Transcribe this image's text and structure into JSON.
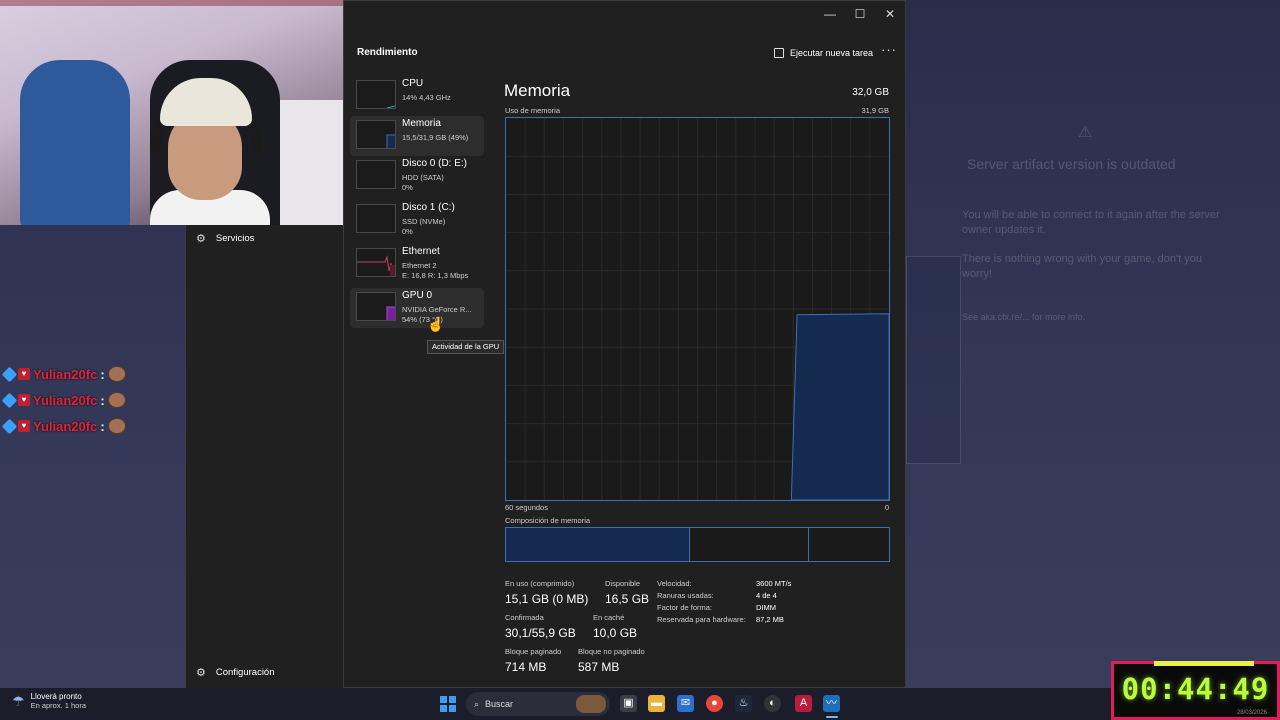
{
  "background_dialog": {
    "title": "Server artifact version is outdated",
    "p1": "You will be able to connect to it again after the server owner updates it.",
    "p2": "There is nothing wrong with your game, don't you worry!",
    "p3": "See aka.cfx.re/... for more info."
  },
  "nav": {
    "services_label": "Servicios",
    "settings_label": "Configuración"
  },
  "chat": {
    "messages": [
      {
        "user": "Yulian20fc",
        "sep": ":"
      },
      {
        "user": "Yulian20fc",
        "sep": ":"
      },
      {
        "user": "Yulian20fc",
        "sep": ":"
      }
    ]
  },
  "task_manager": {
    "section_title": "Rendimiento",
    "run_task_label": "Ejecutar nueva tarea",
    "more_label": "···",
    "window_buttons": {
      "minimize": "—",
      "maximize": "☐",
      "close": "✕"
    },
    "perf_items": [
      {
        "name": "CPU",
        "line1": "14% 4,43 GHz",
        "line2": ""
      },
      {
        "name": "Memoria",
        "line1": "15,5/31,9 GB (49%)",
        "line2": ""
      },
      {
        "name": "Disco 0 (D: E:)",
        "line1": "HDD (SATA)",
        "line2": "0%"
      },
      {
        "name": "Disco 1 (C:)",
        "line1": "SSD (NVMe)",
        "line2": "0%"
      },
      {
        "name": "Ethernet",
        "line1": "Ethernet 2",
        "line2": "E: 16,8 R: 1,3 Mbps"
      },
      {
        "name": "GPU 0",
        "line1": "NVIDIA GeForce R...",
        "line2": "54% (73 °C)"
      }
    ],
    "tooltip": "Actividad de la GPU",
    "memory": {
      "title": "Memoria",
      "total": "32,0 GB",
      "usage_label": "Uso de memoria",
      "usage_max": "31,9 GB",
      "axis_left": "60 segundos",
      "axis_right": "0",
      "composition_label": "Composición de memoria",
      "stats": [
        {
          "label": "En uso (comprimido)",
          "value": "15,1 GB (0 MB)"
        },
        {
          "label": "Disponible",
          "value": "16,5 GB"
        },
        {
          "label": "Confirmada",
          "value": "30,1/55,9 GB"
        },
        {
          "label": "En caché",
          "value": "10,0 GB"
        },
        {
          "label": "Bloque paginado",
          "value": "714 MB"
        },
        {
          "label": "Bloque no paginado",
          "value": "587 MB"
        }
      ],
      "details": [
        {
          "label": "Velocidad:",
          "value": "3600 MT/s"
        },
        {
          "label": "Ranuras usadas:",
          "value": "4 de 4"
        },
        {
          "label": "Factor de forma:",
          "value": "DIMM"
        },
        {
          "label": "Reservada para hardware:",
          "value": "87,2 MB"
        }
      ],
      "usage_fraction": 0.485,
      "composition_fractions": [
        0.48,
        0.31,
        0.21
      ]
    }
  },
  "taskbar": {
    "weather_line1": "Lloverá pronto",
    "weather_line2": "En aprox. 1 hora",
    "search_placeholder": "Buscar"
  },
  "timer": {
    "value": "00:44:49",
    "date": "28/03/2026"
  },
  "colors": {
    "graph_fill": "#142a4e",
    "graph_line": "#3f6fae",
    "timer_text": "#b7ff3c",
    "timer_border": "#e01b5c"
  }
}
